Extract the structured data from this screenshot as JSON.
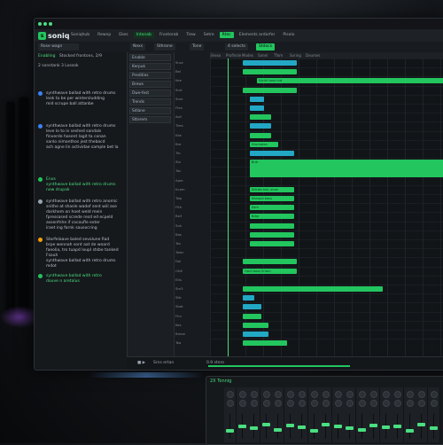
{
  "app": {
    "name": "soniq",
    "logo_mark": "s"
  },
  "menu": [
    "Soniqhub",
    "Rewnp",
    "Ekes",
    "Intonab",
    "Frontorab",
    "Trew",
    "Setre",
    "Rtec",
    "Elements ardorfer",
    "Pisolo"
  ],
  "menu_active_index": 3,
  "menu_button_index": 7,
  "toolbar": {
    "project": "Rose wagn",
    "a": "Nexs",
    "b": "Sthrone",
    "c": "Tone",
    "d": "4 selects",
    "e": "Stdocs"
  },
  "left_panel": {
    "tabs": [
      "Enabling",
      "Stocked frontons, 2/9"
    ],
    "header": "2 sonstank 3 Lossok",
    "items": [
      {
        "text": "synthwave ballad with retro drums\nleok to be per wintersludding\nmid scrupe ball attanbe",
        "green": false,
        "avatar": "#3b82f6"
      },
      {
        "text": "synthwave ballad with retro drums\nleve lo to in seshed sandals\nfinverde hosent lagit ta conan\nsanlo nimanthos jest thebacd\nach agne lin actividae sample bet la",
        "green": false,
        "avatar": "#3b82f6"
      },
      {
        "text": "Enos\nsynthwave ballad with retro drums\nnew drupak",
        "green": true,
        "avatar": "#22c55e"
      },
      {
        "text": "synthwave ballad with retro anomic\nsnithe at shasle wadof sent wiil ase\ndarkhem on hoet weld mein\nfpressased screde resd ed ecpeld\nassenfnhe if cocoufle exter\niraet ing farnk sausocring",
        "green": false,
        "avatar": "#9aa4ae"
      },
      {
        "text": "Storfelaave baled sevolune fiad\nbrpe wennah sont aat de woard\nfaeolia, tro tuapd loupl stsbe tanked\nFsouh\nsynthwave ballad with retro drums\nmdot",
        "green": false,
        "avatar": "#f59e0b"
      },
      {
        "text": "synthwave ballad with retro\ndouve n aretalus",
        "green": true,
        "avatar": "#22c55e"
      }
    ]
  },
  "mid_panel": {
    "rows": [
      "Enable",
      "Kerpuk",
      "Predities",
      "Brews",
      "Dwe-fest",
      "Trends",
      "Sdlane",
      "Stterem"
    ]
  },
  "ruler": [
    "Shexo",
    "Profinsle",
    "Modes",
    "Sanel",
    "Tfom",
    "Soring",
    "Deumes"
  ],
  "tracks": [
    "Srue",
    "Bel",
    "Kee",
    "Smt",
    "Sme",
    "Flen",
    "Aoll",
    "Tkes",
    "Kke",
    "Bre",
    "Tro",
    "Stn",
    "Tav",
    "Aper",
    "Kcam",
    "Twp",
    "Flth",
    "Bo3",
    "Sah",
    "Bas",
    "Tes",
    "Twen",
    "Dol",
    "Oh6",
    "Elts",
    "Sm3",
    "Sttr",
    "Sbet",
    "Flm",
    "Kes",
    "Bmee",
    "Tea"
  ],
  "clips": [
    {
      "row": 0,
      "start": 0.14,
      "len": 0.23,
      "kind": "c",
      "label": ""
    },
    {
      "row": 1,
      "start": 0.14,
      "len": 0.23,
      "kind": "g",
      "label": ""
    },
    {
      "row": 2,
      "start": 0.2,
      "len": 0.8,
      "kind": "g",
      "label": "Synth tone lnd"
    },
    {
      "row": 3,
      "start": 0.14,
      "len": 0.23,
      "kind": "g",
      "label": ""
    },
    {
      "row": 4,
      "start": 0.17,
      "len": 0.06,
      "kind": "c",
      "label": ""
    },
    {
      "row": 5,
      "start": 0.17,
      "len": 0.06,
      "kind": "c",
      "label": ""
    },
    {
      "row": 6,
      "start": 0.17,
      "len": 0.09,
      "kind": "g",
      "label": ""
    },
    {
      "row": 7,
      "start": 0.17,
      "len": 0.09,
      "kind": "c",
      "label": ""
    },
    {
      "row": 8,
      "start": 0.17,
      "len": 0.09,
      "kind": "g",
      "label": ""
    },
    {
      "row": 9,
      "start": 0.17,
      "len": 0.12,
      "kind": "g",
      "label": "Hrumaten"
    },
    {
      "row": 10,
      "start": 0.17,
      "len": 0.19,
      "kind": "c",
      "label": ""
    },
    {
      "row": 11,
      "start": 0.17,
      "len": 0.83,
      "kind": "big",
      "label": "Brdr"
    },
    {
      "row": 14,
      "start": 0.17,
      "len": 0.19,
      "kind": "g",
      "label": "Snbles tod, onon"
    },
    {
      "row": 15,
      "start": 0.17,
      "len": 0.19,
      "kind": "g",
      "label": "Sharpol bass"
    },
    {
      "row": 16,
      "start": 0.17,
      "len": 0.19,
      "kind": "g",
      "label": "Sam"
    },
    {
      "row": 17,
      "start": 0.17,
      "len": 0.19,
      "kind": "g",
      "label": "Bdqr"
    },
    {
      "row": 18,
      "start": 0.17,
      "len": 0.19,
      "kind": "g",
      "label": ""
    },
    {
      "row": 19,
      "start": 0.17,
      "len": 0.19,
      "kind": "g",
      "label": ""
    },
    {
      "row": 20,
      "start": 0.17,
      "len": 0.19,
      "kind": "g",
      "label": ""
    },
    {
      "row": 22,
      "start": 0.14,
      "len": 0.23,
      "kind": "g",
      "label": ""
    },
    {
      "row": 23,
      "start": 0.14,
      "len": 0.23,
      "kind": "g",
      "label": "Gard bass Eriam"
    },
    {
      "row": 25,
      "start": 0.14,
      "len": 0.6,
      "kind": "g",
      "label": ""
    },
    {
      "row": 26,
      "start": 0.14,
      "len": 0.05,
      "kind": "c",
      "label": ""
    },
    {
      "row": 27,
      "start": 0.14,
      "len": 0.08,
      "kind": "c",
      "label": ""
    },
    {
      "row": 28,
      "start": 0.14,
      "len": 0.08,
      "kind": "g",
      "label": ""
    },
    {
      "row": 29,
      "start": 0.14,
      "len": 0.11,
      "kind": "g",
      "label": ""
    },
    {
      "row": 30,
      "start": 0.14,
      "len": 0.11,
      "kind": "c",
      "label": ""
    },
    {
      "row": 31,
      "start": 0.14,
      "len": 0.19,
      "kind": "g",
      "label": ""
    }
  ],
  "bottom_bar": {
    "a": "Srns ertan",
    "b": "0.9 stero",
    "c": "Smlrem"
  },
  "mixer": {
    "title": "2X Tonnig",
    "strips": 18,
    "levels": [
      0.3,
      0.5,
      0.4,
      0.6,
      0.35,
      0.55,
      0.45,
      0.3,
      0.6,
      0.5,
      0.4,
      0.35,
      0.55,
      0.45,
      0.5,
      0.3,
      0.6,
      0.4
    ]
  },
  "colors": {
    "accent": "#22c55e",
    "accent2": "#22a8c5",
    "bg": "#1a1d21"
  }
}
